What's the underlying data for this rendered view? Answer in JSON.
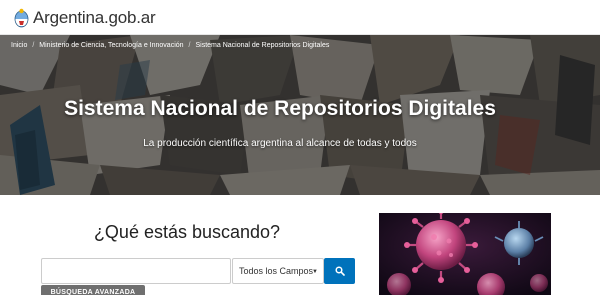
{
  "header": {
    "brand_text": "Argentina.gob.ar",
    "logo_icon": "argentina-coat-of-arms-icon"
  },
  "breadcrumb": [
    {
      "label": "Inicio"
    },
    {
      "label": "Ministerio de Ciencia, Tecnología e Innovación"
    },
    {
      "label": "Sistema Nacional de Repositorios Digitales"
    }
  ],
  "hero": {
    "title": "Sistema Nacional de Repositorios Digitales",
    "subtitle": "La producción científica argentina al alcance de todas y todos"
  },
  "search": {
    "heading": "¿Qué estás buscando?",
    "input_value": "",
    "input_placeholder": "",
    "field_selected": "Todos los Campos",
    "submit_icon": "search-icon",
    "advanced_label": "BÚSQUEDA AVANZADA"
  },
  "side_image": {
    "icon": "coronavirus-illustration"
  },
  "colors": {
    "accent": "#0072bb",
    "advanced_button": "#6f6f6f",
    "hero_overlay": "#141414"
  }
}
